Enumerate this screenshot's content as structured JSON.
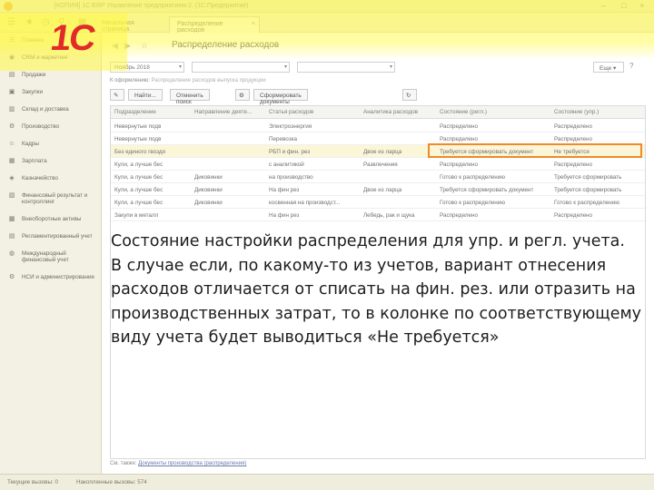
{
  "window": {
    "title": "[КОПИЯ] 1С:ERP Управление предприятием 2. (1С:Предприятие)"
  },
  "tabs": [
    {
      "label": "Начальная страница"
    },
    {
      "label": "Распределение расходов"
    }
  ],
  "sidebar": {
    "items": [
      {
        "label": "Главное",
        "icon": "home-icon"
      },
      {
        "label": "CRM и маркетинг",
        "icon": "crm-icon"
      },
      {
        "label": "Продажи",
        "icon": "cart-icon"
      },
      {
        "label": "Закупки",
        "icon": "basket-icon"
      },
      {
        "label": "Склад и доставка",
        "icon": "warehouse-icon"
      },
      {
        "label": "Производство",
        "icon": "factory-icon"
      },
      {
        "label": "Кадры",
        "icon": "people-icon"
      },
      {
        "label": "Зарплата",
        "icon": "salary-icon"
      },
      {
        "label": "Казначейство",
        "icon": "treasury-icon"
      },
      {
        "label": "Финансовый результат и контроллинг",
        "icon": "chart-icon"
      },
      {
        "label": "Внеоборотные активы",
        "icon": "assets-icon"
      },
      {
        "label": "Регламентированный учет",
        "icon": "ledger-icon"
      },
      {
        "label": "Международный финансовый учет",
        "icon": "globe-icon"
      },
      {
        "label": "НСИ и администрирование",
        "icon": "settings-icon"
      }
    ]
  },
  "main": {
    "title": "Распределение расходов",
    "filters": {
      "month": "Ноябрь 2018",
      "more": "Еще",
      "help": "?"
    },
    "hint_prefix": "К оформлению:",
    "hint_rest": "Распределение расходов выпуска продукции",
    "commands": {
      "find": "Найти...",
      "cancel_search": "Отменить поиск",
      "generate": "Сформировать документы распределения"
    },
    "table": {
      "headers": [
        "Подразделение",
        "Направление деяте...",
        "Статья расходов",
        "Аналитика расходов",
        "Состояние (регл.)",
        "Состояние (упр.)"
      ],
      "rows": [
        [
          "Невернутые подв",
          "",
          "Электроэнергия",
          "",
          "Распределено",
          "Распределено"
        ],
        [
          "Невернутые подв",
          "",
          "Перевозка",
          "",
          "Распределено",
          "Распределено"
        ],
        [
          "Без единого гвоздя",
          "",
          "РБП и фин. рез",
          "Двое из ларца",
          "Требуется сформировать документ",
          "Не требуется"
        ],
        [
          "Кули, а лучше бес",
          "",
          "с аналитикой",
          "Развлечения",
          "Распределено",
          "Распределено"
        ],
        [
          "Кули, а лучше бес",
          "Диковинки",
          "на производство",
          "",
          "Готово к распределению",
          "Требуется сформировать"
        ],
        [
          "Кули, а лучше бес",
          "Диковинки",
          "На фин рез",
          "Двое из ларца",
          "Требуется сформировать документ",
          "Требуется сформировать"
        ],
        [
          "Кули, а лучше бес",
          "Диковинки",
          "косвенная на производст...",
          "",
          "Готово к распределению",
          "Готово к распределению"
        ],
        [
          "Закупи в металл",
          "",
          "На фин рез",
          "Лебедь, рак и щука",
          "Распределено",
          "Распределено"
        ]
      ]
    },
    "footer_prefix": "См. также:",
    "footer_link": "Документы производства (распределения)"
  },
  "annotation": {
    "line1": "Состояние настройки распределения для упр. и регл. учета.",
    "line2": "В случае если, по какому-то из учетов, вариант отнесения",
    "line3": "расходов отличается от списать на фин. рез. или отразить на",
    "line4": "производственных затрат, то в колонке по соответствующему",
    "line5": "виду учета будет выводиться «Не требуется»"
  },
  "statusbar": {
    "current_calls": "Текущие вызовы: 0",
    "accumulated_calls": "Накопленные вызовы: 574"
  },
  "colors": {
    "highlight": "#fff850",
    "logo": "#e12a2a",
    "selection_box": "#f08a28"
  }
}
